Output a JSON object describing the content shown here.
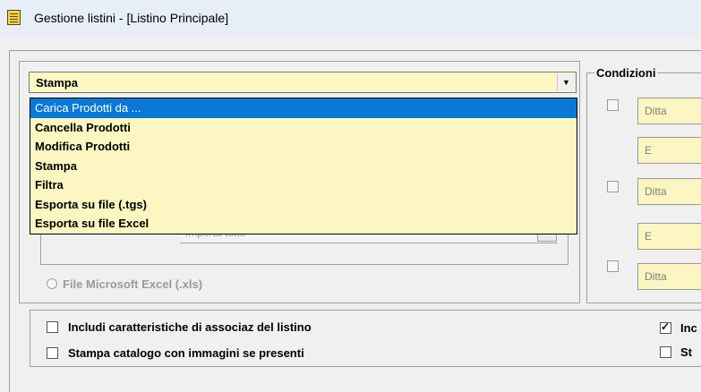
{
  "window": {
    "title": "Gestione listini - [Listino Principale]",
    "icon": "list-document-icon"
  },
  "action_combo": {
    "selected": "Stampa",
    "options": [
      "Carica Prodotti da ...",
      "Cancella Prodotti",
      "Modifica Prodotti",
      "Stampa",
      "Filtra",
      "Esporta su file (.tgs)",
      "Esporta su file Excel"
    ],
    "highlighted_index": 0
  },
  "import_panel": {
    "input_value": "Importa tutto",
    "radio_excel_label": "File Microsoft Excel (.xls)"
  },
  "conditions": {
    "legend": "Condizioni",
    "fields": [
      "Ditta",
      "E",
      "Ditta",
      "E",
      "Ditta"
    ]
  },
  "options": {
    "include_characteristics": {
      "label": "Includi caratteristiche di associaz del listino",
      "checked": false
    },
    "print_catalog_images": {
      "label": "Stampa catalogo con immagini se presenti",
      "checked": false
    }
  },
  "right_options": [
    {
      "label": "Inc",
      "checked": true
    },
    {
      "label": "St",
      "checked": false
    }
  ],
  "colors": {
    "field_bg": "#fbf6c2",
    "selection": "#0a78d7"
  }
}
